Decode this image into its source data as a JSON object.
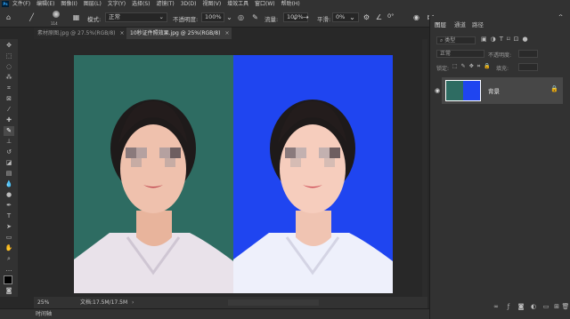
{
  "menubar": {
    "logo": "Ps",
    "items": [
      "文件(F)",
      "编辑(E)",
      "图像(I)",
      "图层(L)",
      "文字(Y)",
      "选择(S)",
      "滤镜(T)",
      "3D(D)",
      "视图(V)",
      "增效工具",
      "窗口(W)",
      "帮助(H)"
    ]
  },
  "options": {
    "brush_size": "114",
    "mode_label": "模式:",
    "mode_value": "正常",
    "opacity_label": "不透明度:",
    "opacity_value": "100%",
    "flow_label": "流量:",
    "flow_value": "100%",
    "smoothing_label": "平滑:",
    "smoothing_value": "0%",
    "angle_value": "0°"
  },
  "tabs": [
    {
      "label": "素材原图.jpg @ 27.5%(RGB/8)",
      "close": "×"
    },
    {
      "label": "10秒证件照效果.jpg @ 25%(RGB/8)",
      "close": "×"
    }
  ],
  "status": {
    "zoom": "25%",
    "doc_info": "文档:17.5M/17.5M"
  },
  "timeline": {
    "label": "时间轴"
  },
  "panel": {
    "tabs": [
      "图层",
      "通道",
      "路径"
    ],
    "kind_label": "类型",
    "blend_mode": "正常",
    "opacity_label": "不透明度:",
    "lock_label": "锁定:",
    "fill_label": "填充:",
    "layer_name": "背景"
  },
  "colors": {
    "left_bg": "#2e6c62",
    "right_bg": "#1f45f0",
    "ui_dark": "#323232",
    "canvas": "#282828"
  }
}
